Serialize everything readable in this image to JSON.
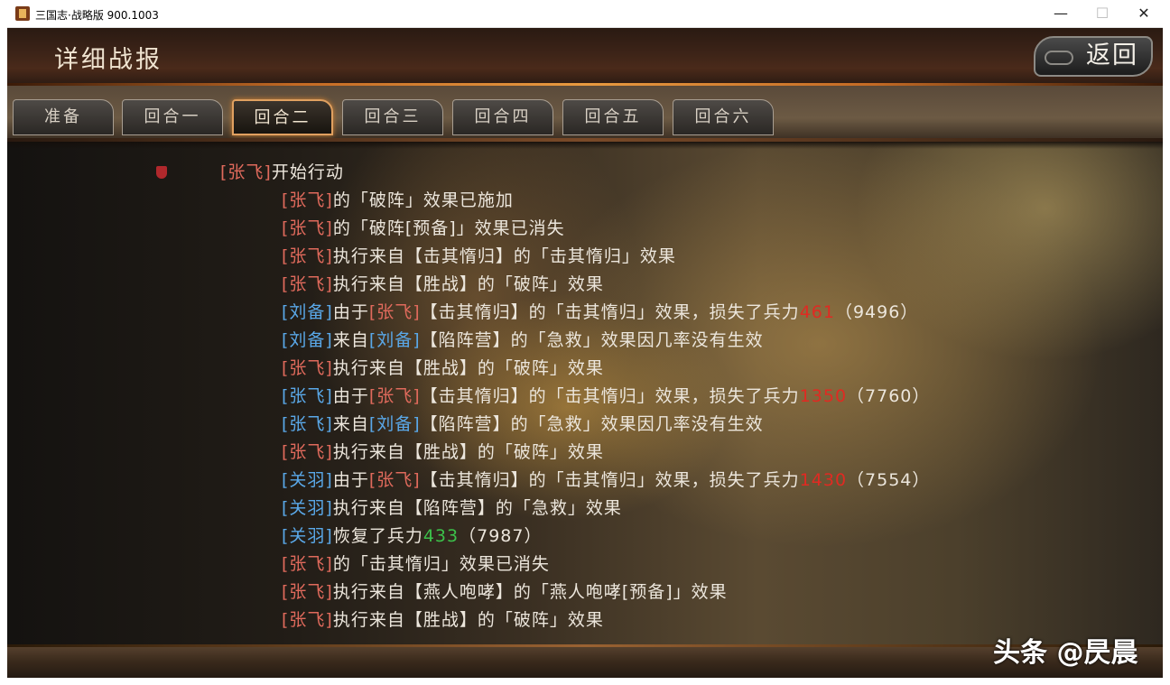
{
  "window": {
    "title": "三国志·战略版 900.1003",
    "min_glyph": "—",
    "max_glyph": "☐",
    "close_glyph": "✕"
  },
  "header": {
    "title": "详细战报",
    "back_label": "返回"
  },
  "tabs": [
    {
      "label": "准备"
    },
    {
      "label": "回合一"
    },
    {
      "label": "回合二",
      "active": true
    },
    {
      "label": "回合三"
    },
    {
      "label": "回合四"
    },
    {
      "label": "回合五"
    },
    {
      "label": "回合六"
    }
  ],
  "log": {
    "actor_line": {
      "name": "[张飞]",
      "text": "开始行动"
    },
    "entries": [
      {
        "name": "[张飞]",
        "name_color": "red",
        "text": "的「破阵」效果已施加"
      },
      {
        "name": "[张飞]",
        "name_color": "red",
        "text": "的「破阵[预备]」效果已消失"
      },
      {
        "name": "[张飞]",
        "name_color": "red",
        "text": "执行来自【击其惰归】的「击其惰归」效果"
      },
      {
        "name": "[张飞]",
        "name_color": "red",
        "text": "执行来自【胜战】的「破阵」效果"
      },
      {
        "name": "[刘备]",
        "name_color": "blue",
        "text": "由于",
        "src": "[张飞]",
        "tail": "【击其惰归】的「击其惰归」效果，损失了兵力",
        "num": "461",
        "num_color": "red",
        "rest": "（9496）"
      },
      {
        "name": "[刘备]",
        "name_color": "blue",
        "text": "来自",
        "src": "[刘备]",
        "src_color": "blue",
        "tail": "【陷阵营】的「急救」效果因几率没有生效"
      },
      {
        "name": "[张飞]",
        "name_color": "red",
        "text": "执行来自【胜战】的「破阵」效果"
      },
      {
        "name": "[张飞]",
        "name_color": "blue",
        "text": "由于",
        "src": "[张飞]",
        "tail": "【击其惰归】的「击其惰归」效果，损失了兵力",
        "num": "1350",
        "num_color": "red",
        "rest": "（7760）"
      },
      {
        "name": "[张飞]",
        "name_color": "blue",
        "text": "来自",
        "src": "[刘备]",
        "src_color": "blue",
        "tail": "【陷阵营】的「急救」效果因几率没有生效"
      },
      {
        "name": "[张飞]",
        "name_color": "red",
        "text": "执行来自【胜战】的「破阵」效果"
      },
      {
        "name": "[关羽]",
        "name_color": "blue",
        "text": "由于",
        "src": "[张飞]",
        "tail": "【击其惰归】的「击其惰归」效果，损失了兵力",
        "num": "1430",
        "num_color": "red",
        "rest": "（7554）"
      },
      {
        "name": "[关羽]",
        "name_color": "blue",
        "text": "执行来自【陷阵营】的「急救」效果"
      },
      {
        "name": "[关羽]",
        "name_color": "blue",
        "text": "恢复了兵力",
        "num": "433",
        "num_color": "green",
        "rest": "（7987）"
      },
      {
        "name": "[张飞]",
        "name_color": "red",
        "text": "的「击其惰归」效果已消失"
      },
      {
        "name": "[张飞]",
        "name_color": "red",
        "text": "执行来自【燕人咆哮】的「燕人咆哮[预备]」效果"
      },
      {
        "name": "[张飞]",
        "name_color": "red",
        "text": "执行来自【胜战】的「破阵」效果"
      }
    ]
  },
  "watermark": "头条 @昃晨",
  "colors": {
    "red_name": "#e06a5c",
    "blue_name": "#5aa8e8",
    "loss_number": "#e02a22",
    "heal_number": "#3cc04a",
    "accent": "#e0a060"
  }
}
